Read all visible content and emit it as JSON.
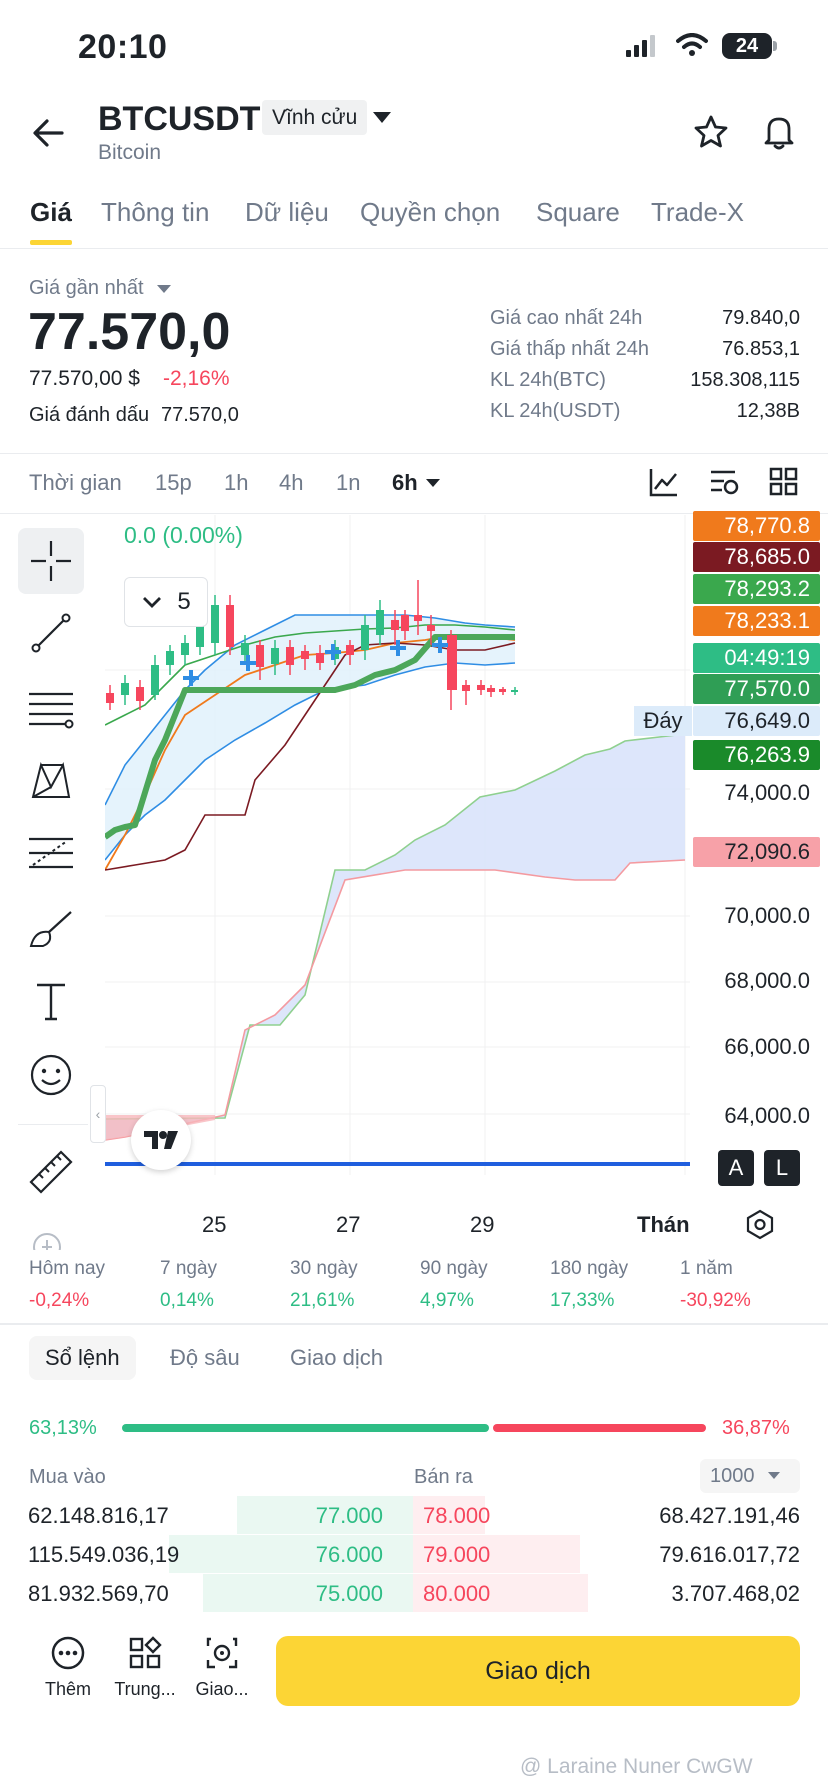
{
  "status_bar": {
    "time": "20:10",
    "battery": "24"
  },
  "header": {
    "symbol": "BTCUSDT",
    "contract_type": "Vĩnh cửu",
    "base_name": "Bitcoin"
  },
  "tabs": [
    "Giá",
    "Thông tin",
    "Dữ liệu",
    "Quyền chọn",
    "Square",
    "Trade-X"
  ],
  "price": {
    "last_price_label": "Giá gần nhất",
    "last_price": "77.570,0",
    "usd_price": "77.570,00 $",
    "change_pct": "-2,16%",
    "mark_label": "Giá đánh dấu",
    "mark_price": "77.570,0"
  },
  "stats": [
    {
      "label": "Giá cao nhất 24h",
      "value": "79.840,0"
    },
    {
      "label": "Giá thấp nhất 24h",
      "value": "76.853,1"
    },
    {
      "label": "KL 24h(BTC)",
      "value": "158.308,115"
    },
    {
      "label": "KL 24h(USDT)",
      "value": "12,38B"
    }
  ],
  "timeframes": {
    "label": "Thời gian",
    "items": [
      "15p",
      "1h",
      "4h",
      "1n",
      "6h"
    ],
    "selected": "6h"
  },
  "chart": {
    "change_text": "0.0 (0.00%)",
    "selector_value": "5",
    "bottom_label": "Đáy",
    "price_tags": [
      {
        "value": "78,770.8",
        "color": "#f07a1c"
      },
      {
        "value": "78,685.0",
        "color": "#7b1a22"
      },
      {
        "value": "78,293.2",
        "color": "#3aa84d"
      },
      {
        "value": "78,233.1",
        "color": "#f07a1c"
      },
      {
        "value": "04:49:19",
        "color": "#2ebd85"
      },
      {
        "value": "77,570.0",
        "color": "#2f9e55"
      },
      {
        "value": "76,649.0",
        "color": "#dcebfa"
      },
      {
        "value": "76,263.9",
        "color": "#1a8a2a"
      },
      {
        "value": "72,090.6",
        "color": "#f7a1a8"
      }
    ],
    "axis_labels": [
      "74,000.0",
      "70,000.0",
      "68,000.0",
      "66,000.0",
      "64,000.0"
    ],
    "date_labels": [
      "25",
      "27",
      "29",
      "Thán"
    ],
    "scale_buttons": [
      "A",
      "L"
    ]
  },
  "performance": [
    {
      "label": "Hôm nay",
      "value": "-0,24%",
      "dir": "down"
    },
    {
      "label": "7 ngày",
      "value": "0,14%",
      "dir": "up"
    },
    {
      "label": "30 ngày",
      "value": "21,61%",
      "dir": "up"
    },
    {
      "label": "90 ngày",
      "value": "4,97%",
      "dir": "up"
    },
    {
      "label": "180 ngày",
      "value": "17,33%",
      "dir": "up"
    },
    {
      "label": "1 năm",
      "value": "-30,92%",
      "dir": "down"
    }
  ],
  "orderbook": {
    "tabs": [
      "Sổ lệnh",
      "Độ sâu",
      "Giao dịch"
    ],
    "buy_pct": "63,13%",
    "sell_pct": "36,87%",
    "buy_ratio": 0.6313,
    "buy_label": "Mua vào",
    "sell_label": "Bán ra",
    "depth_select": "1000",
    "rows": [
      {
        "bid_qty": "62.148.816,17",
        "bid_price": "77.000",
        "ask_price": "78.000",
        "ask_qty": "68.427.191,46",
        "bid_depth": 0.72,
        "ask_depth": 0.19
      },
      {
        "bid_qty": "115.549.036,19",
        "bid_price": "76.000",
        "ask_price": "79.000",
        "ask_qty": "79.616.017,72",
        "bid_depth": 1.0,
        "ask_depth": 0.44
      },
      {
        "bid_qty": "81.932.569,70",
        "bid_price": "75.000",
        "ask_price": "80.000",
        "ask_qty": "3.707.468,02",
        "bid_depth": 0.86,
        "ask_depth": 0.46
      }
    ]
  },
  "bottom_bar": {
    "more": "Thêm",
    "center": "Trung...",
    "trade_short": "Giao...",
    "trade_button": "Giao dịch"
  },
  "watermark": "@ Laraine Nuner CwGW"
}
